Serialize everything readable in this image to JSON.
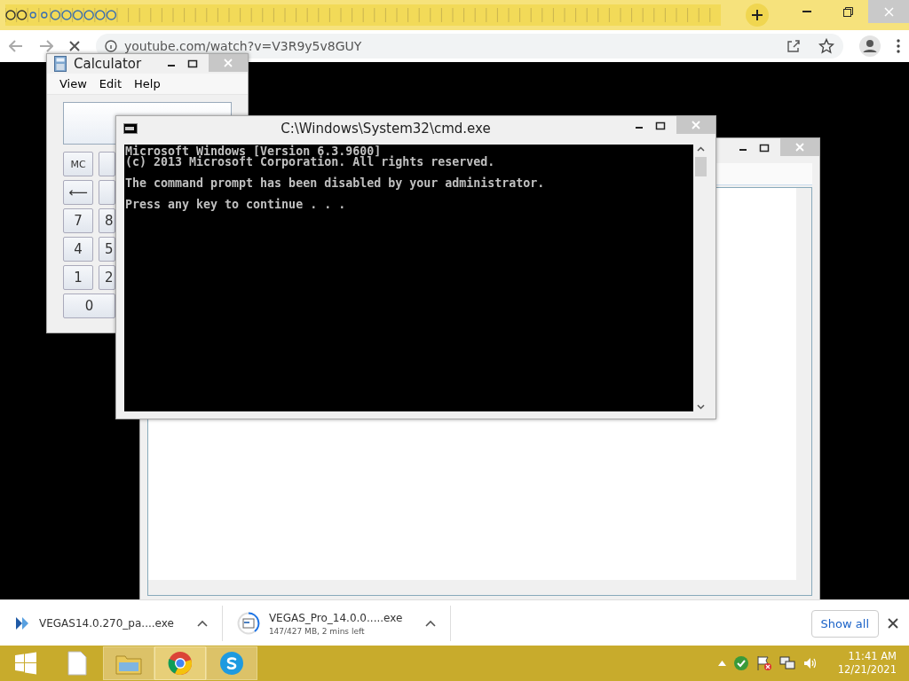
{
  "browser": {
    "address": "youtube.com/watch?v=V3R9y5v8GUY",
    "downloads": [
      {
        "kind": "installer",
        "name": "VEGAS14.0.270_pa....exe"
      },
      {
        "kind": "progress",
        "name": "VEGAS_Pro_14.0.0.....exe",
        "status": "147/427 MB, 2 mins left"
      }
    ],
    "show_all": "Show all"
  },
  "calculator": {
    "title": "Calculator",
    "menu": [
      "View",
      "Edit",
      "Help"
    ],
    "rows": [
      {
        "kind": "normal",
        "keys": [
          "MC"
        ]
      },
      {
        "kind": "normal",
        "keys": [
          "⟵"
        ]
      },
      {
        "kind": "normal",
        "keys": [
          "7",
          "8"
        ]
      },
      {
        "kind": "normal",
        "keys": [
          "4",
          "5"
        ]
      },
      {
        "kind": "normal",
        "keys": [
          "1",
          "2"
        ]
      },
      {
        "kind": "wide",
        "keys": [
          "0"
        ]
      }
    ]
  },
  "cmd": {
    "title": "C:\\Windows\\System32\\cmd.exe",
    "paragraphs": [
      [
        "Microsoft Windows [Version 6.3.9600]",
        "(c) 2013 Microsoft Corporation. All rights reserved."
      ],
      [
        "The command prompt has been disabled by your administrator."
      ],
      [
        "Press any key to continue . . ."
      ]
    ]
  },
  "taskbar": {
    "apps": [
      {
        "kind": "file",
        "selected": false
      },
      {
        "kind": "explorer",
        "selected": false
      },
      {
        "kind": "chrome",
        "selected": true
      },
      {
        "kind": "skype",
        "selected": false
      }
    ],
    "time": "11:41 AM",
    "date": "12/21/2021"
  }
}
